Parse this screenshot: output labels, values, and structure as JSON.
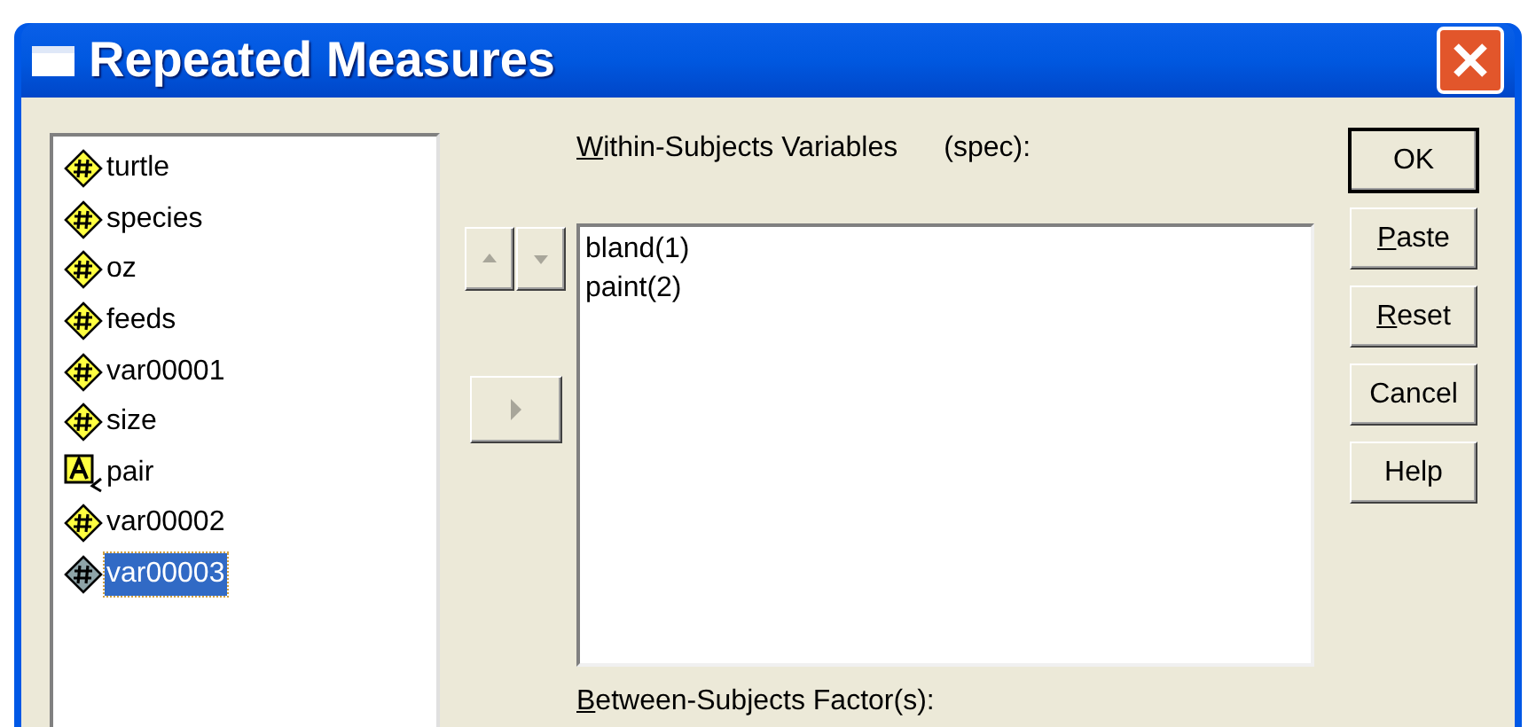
{
  "window": {
    "title": "Repeated Measures"
  },
  "variables": [
    {
      "name": "turtle",
      "kind": "numeric",
      "selected": false
    },
    {
      "name": "species",
      "kind": "numeric",
      "selected": false
    },
    {
      "name": "oz",
      "kind": "numeric",
      "selected": false
    },
    {
      "name": "feeds",
      "kind": "numeric",
      "selected": false
    },
    {
      "name": "var00001",
      "kind": "numeric",
      "selected": false
    },
    {
      "name": "size",
      "kind": "numeric",
      "selected": false
    },
    {
      "name": "pair",
      "kind": "string",
      "selected": false
    },
    {
      "name": "var00002",
      "kind": "numeric",
      "selected": false
    },
    {
      "name": "var00003",
      "kind": "numeric",
      "selected": true
    }
  ],
  "move_buttons": {
    "up_disabled": true,
    "down_disabled": true,
    "transfer_disabled": true
  },
  "within_subjects": {
    "label": "Within-Subjects Variables",
    "label_mnemonic": true,
    "suffix": "(spec):",
    "items": [
      "bland(1)",
      "paint(2)"
    ]
  },
  "between_subjects": {
    "label": "Between-Subjects Factor(s):",
    "label_mnemonic": true
  },
  "buttons": [
    {
      "label": "OK",
      "default": true,
      "mnemonic": false
    },
    {
      "label": "Paste",
      "default": false,
      "mnemonic": true
    },
    {
      "label": "Reset",
      "default": false,
      "mnemonic": true
    },
    {
      "label": "Cancel",
      "default": false,
      "mnemonic": false
    },
    {
      "label": "Help",
      "default": false,
      "mnemonic": false
    }
  ]
}
